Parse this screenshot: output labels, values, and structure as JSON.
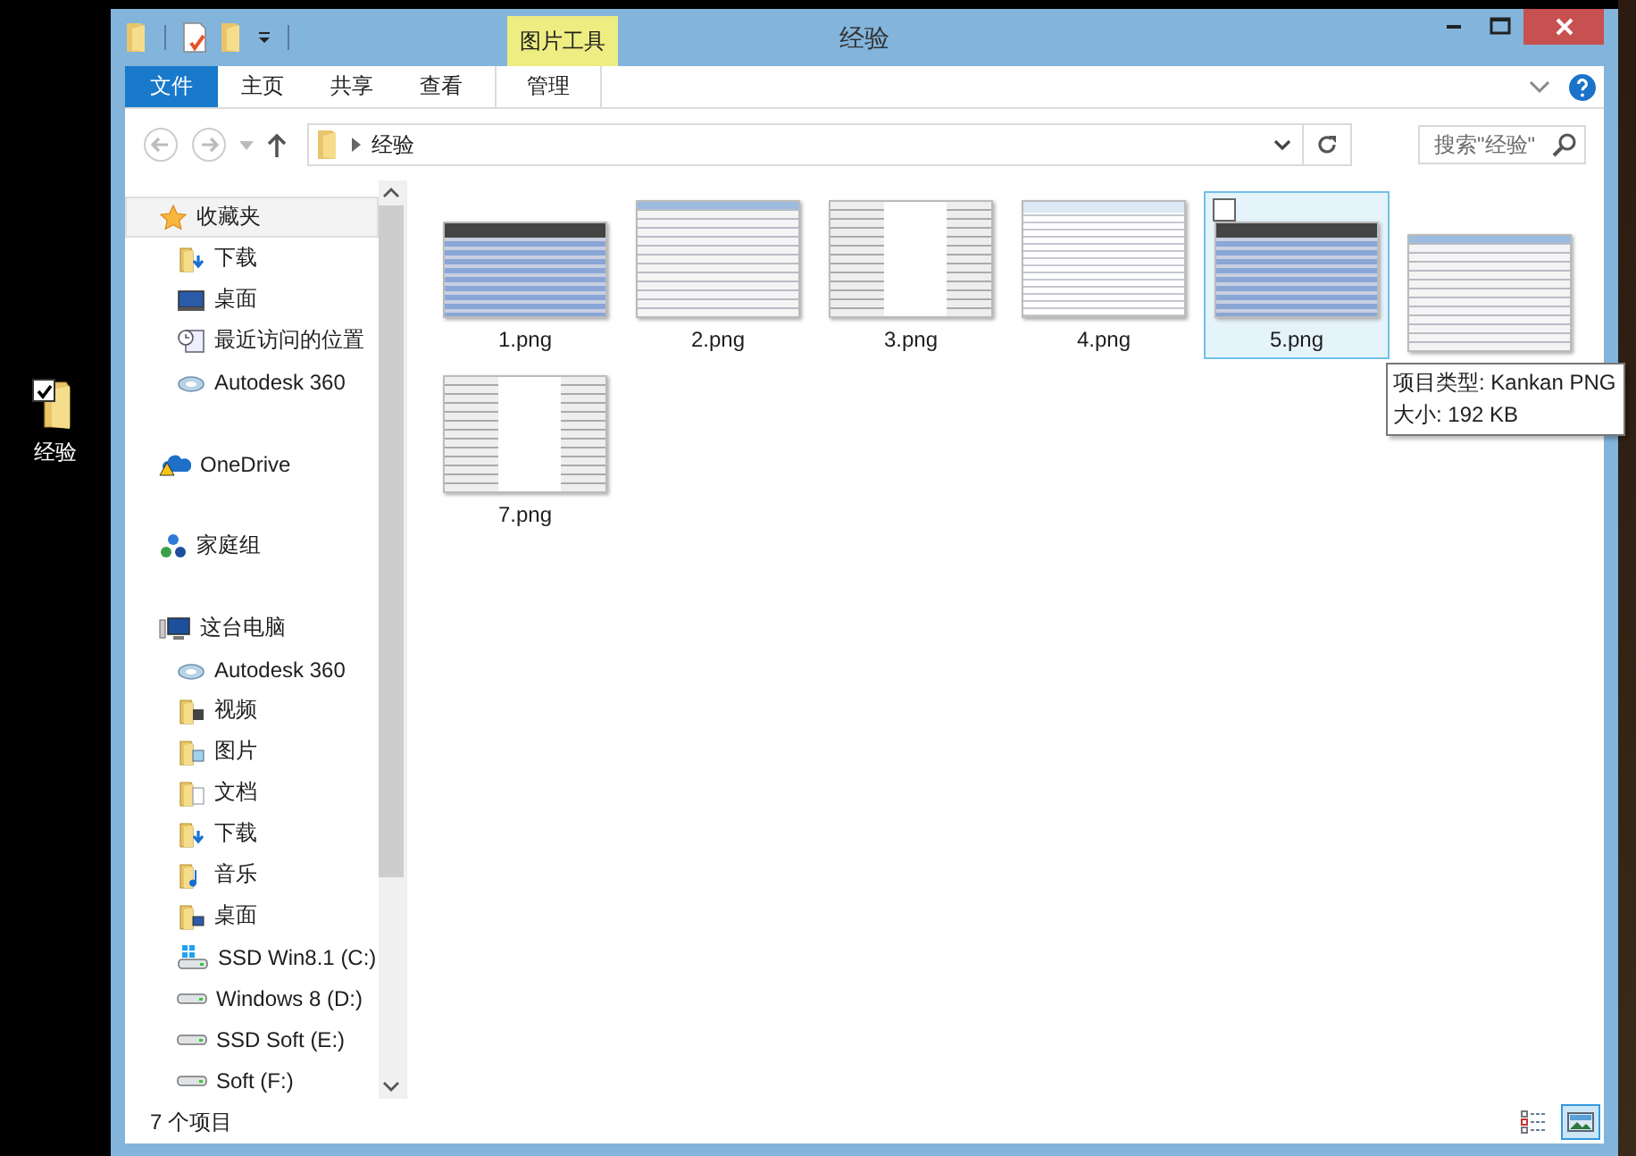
{
  "desktop_icon": {
    "label": "经验",
    "checked": true
  },
  "window": {
    "title": "经验",
    "contextual_tab": "图片工具"
  },
  "ribbon_tabs": [
    {
      "label": "文件",
      "kind": "file",
      "selected": false
    },
    {
      "label": "主页",
      "kind": "tab",
      "selected": false
    },
    {
      "label": "共享",
      "kind": "tab",
      "selected": false
    },
    {
      "label": "查看",
      "kind": "tab",
      "selected": false
    },
    {
      "label": "管理",
      "kind": "contextual",
      "selected": false
    }
  ],
  "address": {
    "path": "经验"
  },
  "search": {
    "placeholder": "搜索\"经验\""
  },
  "sidebar": {
    "items": [
      {
        "label": "收藏夹",
        "kind": "star",
        "selected": true,
        "children": [
          {
            "label": "下载",
            "kind": "download-folder",
            "selected": false
          },
          {
            "label": "桌面",
            "kind": "monitor",
            "selected": false
          },
          {
            "label": "最近访问的位置",
            "kind": "recent",
            "selected": false
          },
          {
            "label": "Autodesk 360",
            "kind": "cloud",
            "selected": false
          }
        ]
      },
      {
        "label": "OneDrive",
        "kind": "onedrive",
        "selected": false
      },
      {
        "label": "家庭组",
        "kind": "homegroup",
        "selected": false
      },
      {
        "label": "这台电脑",
        "kind": "computer",
        "selected": false,
        "children": [
          {
            "label": "Autodesk 360",
            "kind": "cloud",
            "selected": false
          },
          {
            "label": "视频",
            "kind": "video-folder",
            "selected": false
          },
          {
            "label": "图片",
            "kind": "picture-folder",
            "selected": false
          },
          {
            "label": "文档",
            "kind": "document-folder",
            "selected": false
          },
          {
            "label": "下载",
            "kind": "download-folder",
            "selected": false
          },
          {
            "label": "音乐",
            "kind": "music-folder",
            "selected": false
          },
          {
            "label": "桌面",
            "kind": "desktop-folder",
            "selected": false
          },
          {
            "label": "SSD Win8.1 (C:)",
            "kind": "system-drive",
            "selected": false
          },
          {
            "label": "Windows 8 (D:)",
            "kind": "drive",
            "selected": false
          },
          {
            "label": "SSD Soft (E:)",
            "kind": "drive",
            "selected": false
          },
          {
            "label": "Soft (F:)",
            "kind": "drive",
            "selected": false
          }
        ]
      }
    ]
  },
  "files": [
    {
      "name": "1.png",
      "selected": false
    },
    {
      "name": "2.png",
      "selected": false
    },
    {
      "name": "3.png",
      "selected": false
    },
    {
      "name": "4.png",
      "selected": false
    },
    {
      "name": "5.png",
      "selected": true
    },
    {
      "selected": false
    },
    {
      "name": "7.png",
      "selected": false
    }
  ],
  "tooltip": {
    "lines": [
      "项目类型: Kankan PNG",
      "大小: 192 KB"
    ]
  },
  "status_bar": {
    "text": "7 个项目",
    "views": [
      {
        "kind": "details",
        "selected": false
      },
      {
        "kind": "large-icons",
        "selected": true
      }
    ]
  }
}
